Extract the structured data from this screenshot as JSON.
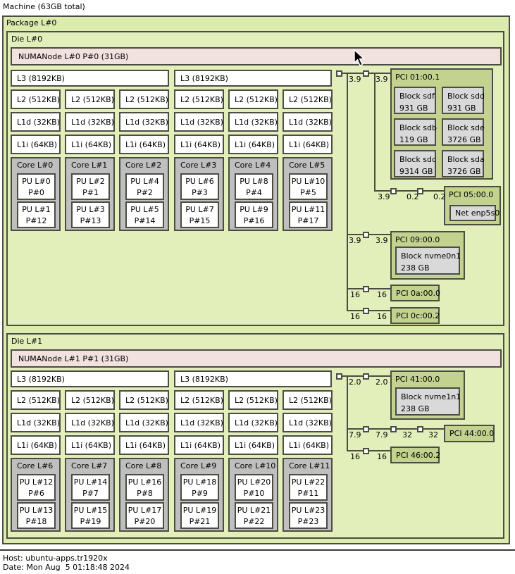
{
  "machine": {
    "label": "Machine (63GB total)"
  },
  "legend": {
    "host": "Host: ubuntu-apps.tr1920x",
    "date": "Date: Mon Aug  5 01:18:48 2024"
  },
  "colors": {
    "package_fill": "#dcebae",
    "die_fill": "#e3efbb",
    "numa_fill": "#f1e1df",
    "pci_fill": "#c3d28f",
    "device_fill": "#d9d9d9",
    "core_fill": "#bfbfbf",
    "cache_fill": "#ffffff",
    "border": "#4c4c42"
  },
  "package": {
    "label": "Package L#0",
    "dies": [
      {
        "label": "Die L#0",
        "numa": "NUMANode L#0 P#0 (31GB)",
        "l3": [
          "L3 (8192KB)",
          "L3 (8192KB)"
        ],
        "l2": [
          "L2 (512KB)",
          "L2 (512KB)",
          "L2 (512KB)",
          "L2 (512KB)",
          "L2 (512KB)",
          "L2 (512KB)"
        ],
        "l1d": [
          "L1d (32KB)",
          "L1d (32KB)",
          "L1d (32KB)",
          "L1d (32KB)",
          "L1d (32KB)",
          "L1d (32KB)"
        ],
        "l1i": [
          "L1i (64KB)",
          "L1i (64KB)",
          "L1i (64KB)",
          "L1i (64KB)",
          "L1i (64KB)",
          "L1i (64KB)"
        ],
        "cores": [
          {
            "label": "Core L#0",
            "pus": [
              [
                "PU L#0",
                "P#0"
              ],
              [
                "PU L#1",
                "P#12"
              ]
            ]
          },
          {
            "label": "Core L#1",
            "pus": [
              [
                "PU L#2",
                "P#1"
              ],
              [
                "PU L#3",
                "P#13"
              ]
            ]
          },
          {
            "label": "Core L#2",
            "pus": [
              [
                "PU L#4",
                "P#2"
              ],
              [
                "PU L#5",
                "P#14"
              ]
            ]
          },
          {
            "label": "Core L#3",
            "pus": [
              [
                "PU L#6",
                "P#3"
              ],
              [
                "PU L#7",
                "P#15"
              ]
            ]
          },
          {
            "label": "Core L#4",
            "pus": [
              [
                "PU L#8",
                "P#4"
              ],
              [
                "PU L#9",
                "P#16"
              ]
            ]
          },
          {
            "label": "Core L#5",
            "pus": [
              [
                "PU L#10",
                "P#5"
              ],
              [
                "PU L#11",
                "P#17"
              ]
            ]
          }
        ],
        "pci": {
          "pci01": {
            "label": "PCI 01:00.1",
            "blocks": [
              [
                "Block sdf",
                "931 GB"
              ],
              [
                "Block sdd",
                "931 GB"
              ],
              [
                "Block sdb",
                "119 GB"
              ],
              [
                "Block sde",
                "3726 GB"
              ],
              [
                "Block sdc",
                "9314 GB"
              ],
              [
                "Block sda",
                "3726 GB"
              ]
            ]
          },
          "pci05": {
            "label": "PCI 05:00.0",
            "net": "Net enp5s0"
          },
          "pci09": {
            "label": "PCI 09:00.0",
            "block": [
              "Block nvme0n1",
              "238 GB"
            ]
          },
          "pci0a": {
            "label": "PCI 0a:00.0"
          },
          "pci0c": {
            "label": "PCI 0c:00.2"
          },
          "speeds": {
            "a1": "3.9",
            "a2": "3.9",
            "s1": "3.9",
            "s2": "0.2",
            "s3": "0.2",
            "b1": "3.9",
            "b2": "3.9",
            "c1": "16",
            "c2": "16",
            "d1": "16",
            "d2": "16"
          }
        }
      },
      {
        "label": "Die L#1",
        "numa": "NUMANode L#1 P#1 (31GB)",
        "l3": [
          "L3 (8192KB)",
          "L3 (8192KB)"
        ],
        "l2": [
          "L2 (512KB)",
          "L2 (512KB)",
          "L2 (512KB)",
          "L2 (512KB)",
          "L2 (512KB)",
          "L2 (512KB)"
        ],
        "l1d": [
          "L1d (32KB)",
          "L1d (32KB)",
          "L1d (32KB)",
          "L1d (32KB)",
          "L1d (32KB)",
          "L1d (32KB)"
        ],
        "l1i": [
          "L1i (64KB)",
          "L1i (64KB)",
          "L1i (64KB)",
          "L1i (64KB)",
          "L1i (64KB)",
          "L1i (64KB)"
        ],
        "cores": [
          {
            "label": "Core L#6",
            "pus": [
              [
                "PU L#12",
                "P#6"
              ],
              [
                "PU L#13",
                "P#18"
              ]
            ]
          },
          {
            "label": "Core L#7",
            "pus": [
              [
                "PU L#14",
                "P#7"
              ],
              [
                "PU L#15",
                "P#19"
              ]
            ]
          },
          {
            "label": "Core L#8",
            "pus": [
              [
                "PU L#16",
                "P#8"
              ],
              [
                "PU L#17",
                "P#20"
              ]
            ]
          },
          {
            "label": "Core L#9",
            "pus": [
              [
                "PU L#18",
                "P#9"
              ],
              [
                "PU L#19",
                "P#21"
              ]
            ]
          },
          {
            "label": "Core L#10",
            "pus": [
              [
                "PU L#20",
                "P#10"
              ],
              [
                "PU L#21",
                "P#22"
              ]
            ]
          },
          {
            "label": "Core L#11",
            "pus": [
              [
                "PU L#22",
                "P#11"
              ],
              [
                "PU L#23",
                "P#23"
              ]
            ]
          }
        ],
        "pci": {
          "pci41": {
            "label": "PCI 41:00.0",
            "block": [
              "Block nvme1n1",
              "238 GB"
            ]
          },
          "pci44": {
            "label": "PCI 44:00.0"
          },
          "pci46": {
            "label": "PCI 46:00.2"
          },
          "speeds": {
            "a1": "2.0",
            "a2": "2.0",
            "b1": "7.9",
            "b2": "7.9",
            "b3": "32",
            "b4": "32",
            "c1": "16",
            "c2": "16"
          }
        }
      }
    ]
  }
}
